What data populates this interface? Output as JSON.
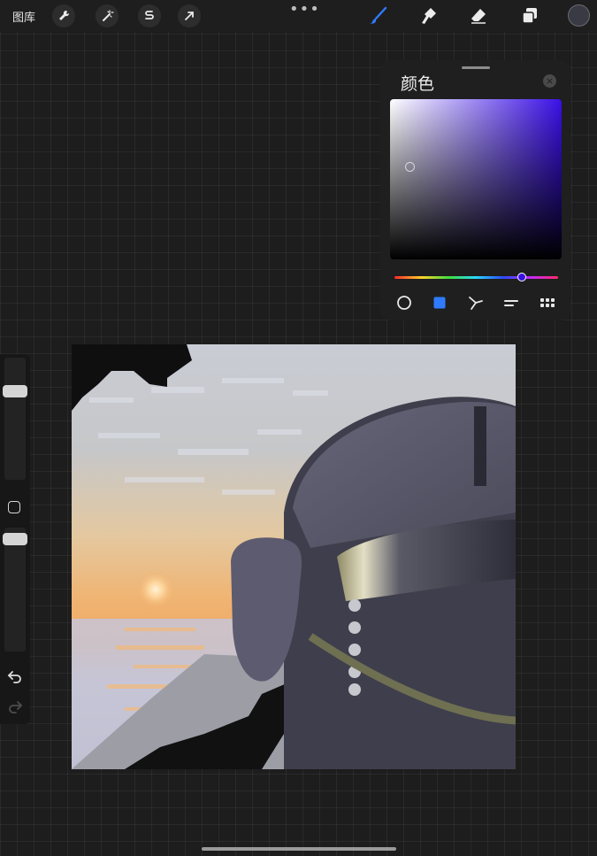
{
  "toolbar": {
    "gallery_label": "图库",
    "left_tools": [
      "wrench-icon",
      "magic-wand-icon",
      "selection-icon",
      "transform-arrow-icon"
    ],
    "more_label": "•••",
    "right_tools": [
      "brush-icon",
      "smudge-icon",
      "eraser-icon",
      "layers-icon"
    ],
    "active_tool": "brush-icon",
    "current_color": "#3a3a44",
    "accent": "#2f7bff"
  },
  "color_panel": {
    "title": "颜色",
    "close_label": "×",
    "hue_color": "#3a10e6",
    "modes": [
      "disc-mode-icon",
      "classic-mode-icon",
      "harmony-mode-icon",
      "value-mode-icon",
      "palettes-mode-icon"
    ],
    "active_mode": "classic-mode-icon"
  },
  "sidebar": {
    "brush_size": 0.75,
    "brush_opacity": 0.95
  }
}
